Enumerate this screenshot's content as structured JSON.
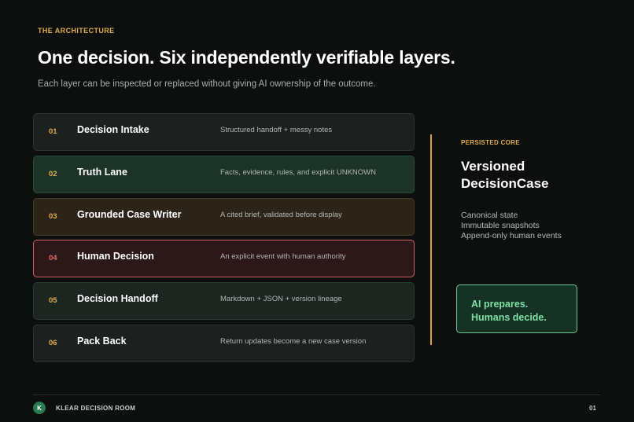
{
  "header": {
    "eyebrow": "THE ARCHITECTURE",
    "title": "One decision. Six independently verifiable layers.",
    "subtitle": "Each layer can be inspected or replaced without giving AI ownership of the outcome."
  },
  "layers": [
    {
      "num": "01",
      "name": "Decision Intake",
      "desc": "Structured handoff + messy notes"
    },
    {
      "num": "02",
      "name": "Truth Lane",
      "desc": "Facts, evidence, rules, and explicit UNKNOWN"
    },
    {
      "num": "03",
      "name": "Grounded Case Writer",
      "desc": "A cited brief, validated before display"
    },
    {
      "num": "04",
      "name": "Human Decision",
      "desc": "An explicit event with human authority"
    },
    {
      "num": "05",
      "name": "Decision Handoff",
      "desc": "Markdown + JSON + version lineage"
    },
    {
      "num": "06",
      "name": "Pack Back",
      "desc": "Return updates become a new case version"
    }
  ],
  "core": {
    "eyebrow": "PERSISTED CORE",
    "title_line1": "Versioned",
    "title_line2": "DecisionCase",
    "items": [
      "Canonical state",
      "Immutable snapshots",
      "Append-only human events"
    ]
  },
  "callout": {
    "line1": "AI prepares.",
    "line2": "Humans decide."
  },
  "footer": {
    "logo_letter": "K",
    "brand": "KLEAR DECISION ROOM",
    "page": "01"
  },
  "colors": {
    "background": "#0c0f0e",
    "accent_gold": "#e0ac4a",
    "accent_green": "#7ee0a5",
    "accent_red": "#d46262"
  }
}
